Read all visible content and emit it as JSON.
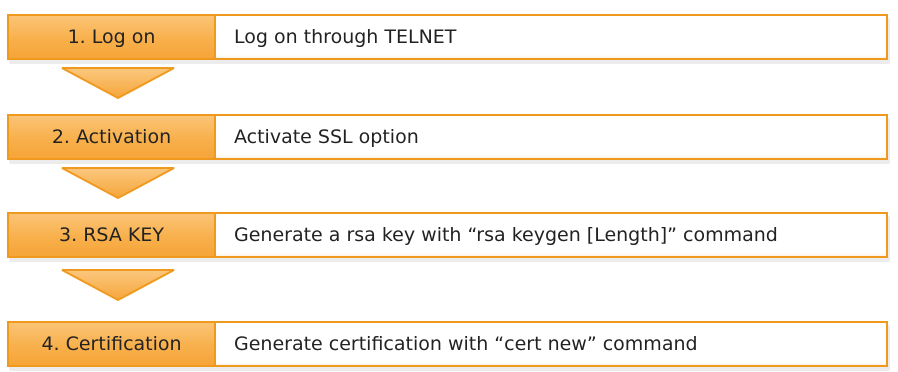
{
  "steps": [
    {
      "label": "1. Log on",
      "description": "Log on through TELNET"
    },
    {
      "label": "2. Activation",
      "description": "Activate SSL option"
    },
    {
      "label": "3. RSA KEY",
      "description": "Generate a rsa key with “rsa keygen [Length]” command"
    },
    {
      "label": "4. Certification",
      "description": "Generate certification with “cert new” command"
    }
  ],
  "colors": {
    "accent": "#ef9a1f",
    "label_fill": "#f8b04c",
    "arrow_fill": "#f7b25a"
  }
}
